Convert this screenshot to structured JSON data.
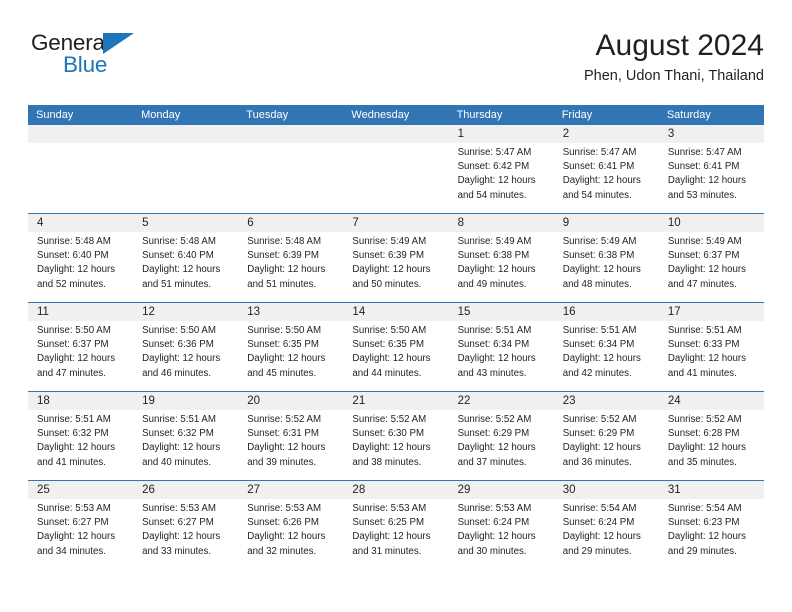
{
  "brand": {
    "name_top": "General",
    "name_bottom": "Blue",
    "accent_color": "#1d76bc"
  },
  "header": {
    "title": "August 2024",
    "subtitle": "Phen, Udon Thani, Thailand"
  },
  "colors": {
    "header_blue": "#3275b5",
    "date_band_gray": "#f0f0f0",
    "text": "#231f20"
  },
  "weekday_headers": [
    "Sunday",
    "Monday",
    "Tuesday",
    "Wednesday",
    "Thursday",
    "Friday",
    "Saturday"
  ],
  "weeks": [
    [
      {
        "day": "",
        "sunrise": "",
        "sunset": "",
        "daylight_1": "",
        "daylight_2": ""
      },
      {
        "day": "",
        "sunrise": "",
        "sunset": "",
        "daylight_1": "",
        "daylight_2": ""
      },
      {
        "day": "",
        "sunrise": "",
        "sunset": "",
        "daylight_1": "",
        "daylight_2": ""
      },
      {
        "day": "",
        "sunrise": "",
        "sunset": "",
        "daylight_1": "",
        "daylight_2": ""
      },
      {
        "day": "1",
        "sunrise": "Sunrise: 5:47 AM",
        "sunset": "Sunset: 6:42 PM",
        "daylight_1": "Daylight: 12 hours",
        "daylight_2": "and 54 minutes."
      },
      {
        "day": "2",
        "sunrise": "Sunrise: 5:47 AM",
        "sunset": "Sunset: 6:41 PM",
        "daylight_1": "Daylight: 12 hours",
        "daylight_2": "and 54 minutes."
      },
      {
        "day": "3",
        "sunrise": "Sunrise: 5:47 AM",
        "sunset": "Sunset: 6:41 PM",
        "daylight_1": "Daylight: 12 hours",
        "daylight_2": "and 53 minutes."
      }
    ],
    [
      {
        "day": "4",
        "sunrise": "Sunrise: 5:48 AM",
        "sunset": "Sunset: 6:40 PM",
        "daylight_1": "Daylight: 12 hours",
        "daylight_2": "and 52 minutes."
      },
      {
        "day": "5",
        "sunrise": "Sunrise: 5:48 AM",
        "sunset": "Sunset: 6:40 PM",
        "daylight_1": "Daylight: 12 hours",
        "daylight_2": "and 51 minutes."
      },
      {
        "day": "6",
        "sunrise": "Sunrise: 5:48 AM",
        "sunset": "Sunset: 6:39 PM",
        "daylight_1": "Daylight: 12 hours",
        "daylight_2": "and 51 minutes."
      },
      {
        "day": "7",
        "sunrise": "Sunrise: 5:49 AM",
        "sunset": "Sunset: 6:39 PM",
        "daylight_1": "Daylight: 12 hours",
        "daylight_2": "and 50 minutes."
      },
      {
        "day": "8",
        "sunrise": "Sunrise: 5:49 AM",
        "sunset": "Sunset: 6:38 PM",
        "daylight_1": "Daylight: 12 hours",
        "daylight_2": "and 49 minutes."
      },
      {
        "day": "9",
        "sunrise": "Sunrise: 5:49 AM",
        "sunset": "Sunset: 6:38 PM",
        "daylight_1": "Daylight: 12 hours",
        "daylight_2": "and 48 minutes."
      },
      {
        "day": "10",
        "sunrise": "Sunrise: 5:49 AM",
        "sunset": "Sunset: 6:37 PM",
        "daylight_1": "Daylight: 12 hours",
        "daylight_2": "and 47 minutes."
      }
    ],
    [
      {
        "day": "11",
        "sunrise": "Sunrise: 5:50 AM",
        "sunset": "Sunset: 6:37 PM",
        "daylight_1": "Daylight: 12 hours",
        "daylight_2": "and 47 minutes."
      },
      {
        "day": "12",
        "sunrise": "Sunrise: 5:50 AM",
        "sunset": "Sunset: 6:36 PM",
        "daylight_1": "Daylight: 12 hours",
        "daylight_2": "and 46 minutes."
      },
      {
        "day": "13",
        "sunrise": "Sunrise: 5:50 AM",
        "sunset": "Sunset: 6:35 PM",
        "daylight_1": "Daylight: 12 hours",
        "daylight_2": "and 45 minutes."
      },
      {
        "day": "14",
        "sunrise": "Sunrise: 5:50 AM",
        "sunset": "Sunset: 6:35 PM",
        "daylight_1": "Daylight: 12 hours",
        "daylight_2": "and 44 minutes."
      },
      {
        "day": "15",
        "sunrise": "Sunrise: 5:51 AM",
        "sunset": "Sunset: 6:34 PM",
        "daylight_1": "Daylight: 12 hours",
        "daylight_2": "and 43 minutes."
      },
      {
        "day": "16",
        "sunrise": "Sunrise: 5:51 AM",
        "sunset": "Sunset: 6:34 PM",
        "daylight_1": "Daylight: 12 hours",
        "daylight_2": "and 42 minutes."
      },
      {
        "day": "17",
        "sunrise": "Sunrise: 5:51 AM",
        "sunset": "Sunset: 6:33 PM",
        "daylight_1": "Daylight: 12 hours",
        "daylight_2": "and 41 minutes."
      }
    ],
    [
      {
        "day": "18",
        "sunrise": "Sunrise: 5:51 AM",
        "sunset": "Sunset: 6:32 PM",
        "daylight_1": "Daylight: 12 hours",
        "daylight_2": "and 41 minutes."
      },
      {
        "day": "19",
        "sunrise": "Sunrise: 5:51 AM",
        "sunset": "Sunset: 6:32 PM",
        "daylight_1": "Daylight: 12 hours",
        "daylight_2": "and 40 minutes."
      },
      {
        "day": "20",
        "sunrise": "Sunrise: 5:52 AM",
        "sunset": "Sunset: 6:31 PM",
        "daylight_1": "Daylight: 12 hours",
        "daylight_2": "and 39 minutes."
      },
      {
        "day": "21",
        "sunrise": "Sunrise: 5:52 AM",
        "sunset": "Sunset: 6:30 PM",
        "daylight_1": "Daylight: 12 hours",
        "daylight_2": "and 38 minutes."
      },
      {
        "day": "22",
        "sunrise": "Sunrise: 5:52 AM",
        "sunset": "Sunset: 6:29 PM",
        "daylight_1": "Daylight: 12 hours",
        "daylight_2": "and 37 minutes."
      },
      {
        "day": "23",
        "sunrise": "Sunrise: 5:52 AM",
        "sunset": "Sunset: 6:29 PM",
        "daylight_1": "Daylight: 12 hours",
        "daylight_2": "and 36 minutes."
      },
      {
        "day": "24",
        "sunrise": "Sunrise: 5:52 AM",
        "sunset": "Sunset: 6:28 PM",
        "daylight_1": "Daylight: 12 hours",
        "daylight_2": "and 35 minutes."
      }
    ],
    [
      {
        "day": "25",
        "sunrise": "Sunrise: 5:53 AM",
        "sunset": "Sunset: 6:27 PM",
        "daylight_1": "Daylight: 12 hours",
        "daylight_2": "and 34 minutes."
      },
      {
        "day": "26",
        "sunrise": "Sunrise: 5:53 AM",
        "sunset": "Sunset: 6:27 PM",
        "daylight_1": "Daylight: 12 hours",
        "daylight_2": "and 33 minutes."
      },
      {
        "day": "27",
        "sunrise": "Sunrise: 5:53 AM",
        "sunset": "Sunset: 6:26 PM",
        "daylight_1": "Daylight: 12 hours",
        "daylight_2": "and 32 minutes."
      },
      {
        "day": "28",
        "sunrise": "Sunrise: 5:53 AM",
        "sunset": "Sunset: 6:25 PM",
        "daylight_1": "Daylight: 12 hours",
        "daylight_2": "and 31 minutes."
      },
      {
        "day": "29",
        "sunrise": "Sunrise: 5:53 AM",
        "sunset": "Sunset: 6:24 PM",
        "daylight_1": "Daylight: 12 hours",
        "daylight_2": "and 30 minutes."
      },
      {
        "day": "30",
        "sunrise": "Sunrise: 5:54 AM",
        "sunset": "Sunset: 6:24 PM",
        "daylight_1": "Daylight: 12 hours",
        "daylight_2": "and 29 minutes."
      },
      {
        "day": "31",
        "sunrise": "Sunrise: 5:54 AM",
        "sunset": "Sunset: 6:23 PM",
        "daylight_1": "Daylight: 12 hours",
        "daylight_2": "and 29 minutes."
      }
    ]
  ]
}
